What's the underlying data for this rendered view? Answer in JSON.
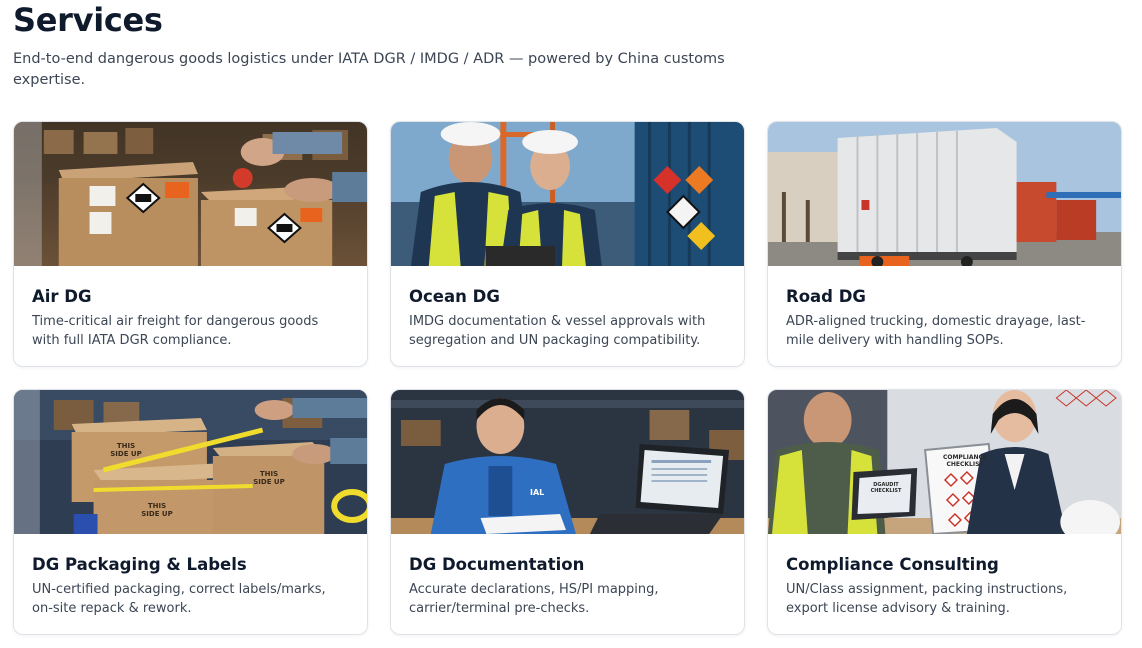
{
  "header": {
    "title": "Services",
    "subtitle": "End-to-end dangerous goods logistics under IATA DGR / IMDG / ADR — powered by China customs expertise."
  },
  "services": [
    {
      "title": "Air DG",
      "description": "Time-critical air freight for dangerous goods with full IATA DGR compliance.",
      "image_icon": "dg-boxes-photo"
    },
    {
      "title": "Ocean DG",
      "description": "IMDG documentation & vessel approvals with segregation and UN packaging compatibility.",
      "image_icon": "port-workers-photo"
    },
    {
      "title": "Road DG",
      "description": "ADR-aligned trucking, domestic drayage, last-mile delivery with handling SOPs.",
      "image_icon": "truck-trailer-photo"
    },
    {
      "title": "DG Packaging & Labels",
      "description": "UN-certified packaging, correct labels/marks, on-site repack & rework.",
      "image_icon": "packing-boxes-photo",
      "box_text": "THIS SIDE UP"
    },
    {
      "title": "DG Documentation",
      "description": "Accurate declarations, HS/PI mapping, carrier/terminal pre-checks.",
      "image_icon": "documentation-worker-photo",
      "badge_text": "IAL"
    },
    {
      "title": "Compliance Consulting",
      "description": "UN/Class assignment, packing instructions, export license advisory & training.",
      "image_icon": "consulting-meeting-photo",
      "board_text": "COMPLIANCE CHECKLIST",
      "laptop_text": "DGAUDIT CHECKLIST"
    }
  ],
  "colors": {
    "title": "#0f1b2d",
    "body_text": "#3c4654",
    "card_border": "#dfe3e8",
    "hazard_orange": "#e8641e",
    "vest_yellow": "#d6e23a"
  }
}
